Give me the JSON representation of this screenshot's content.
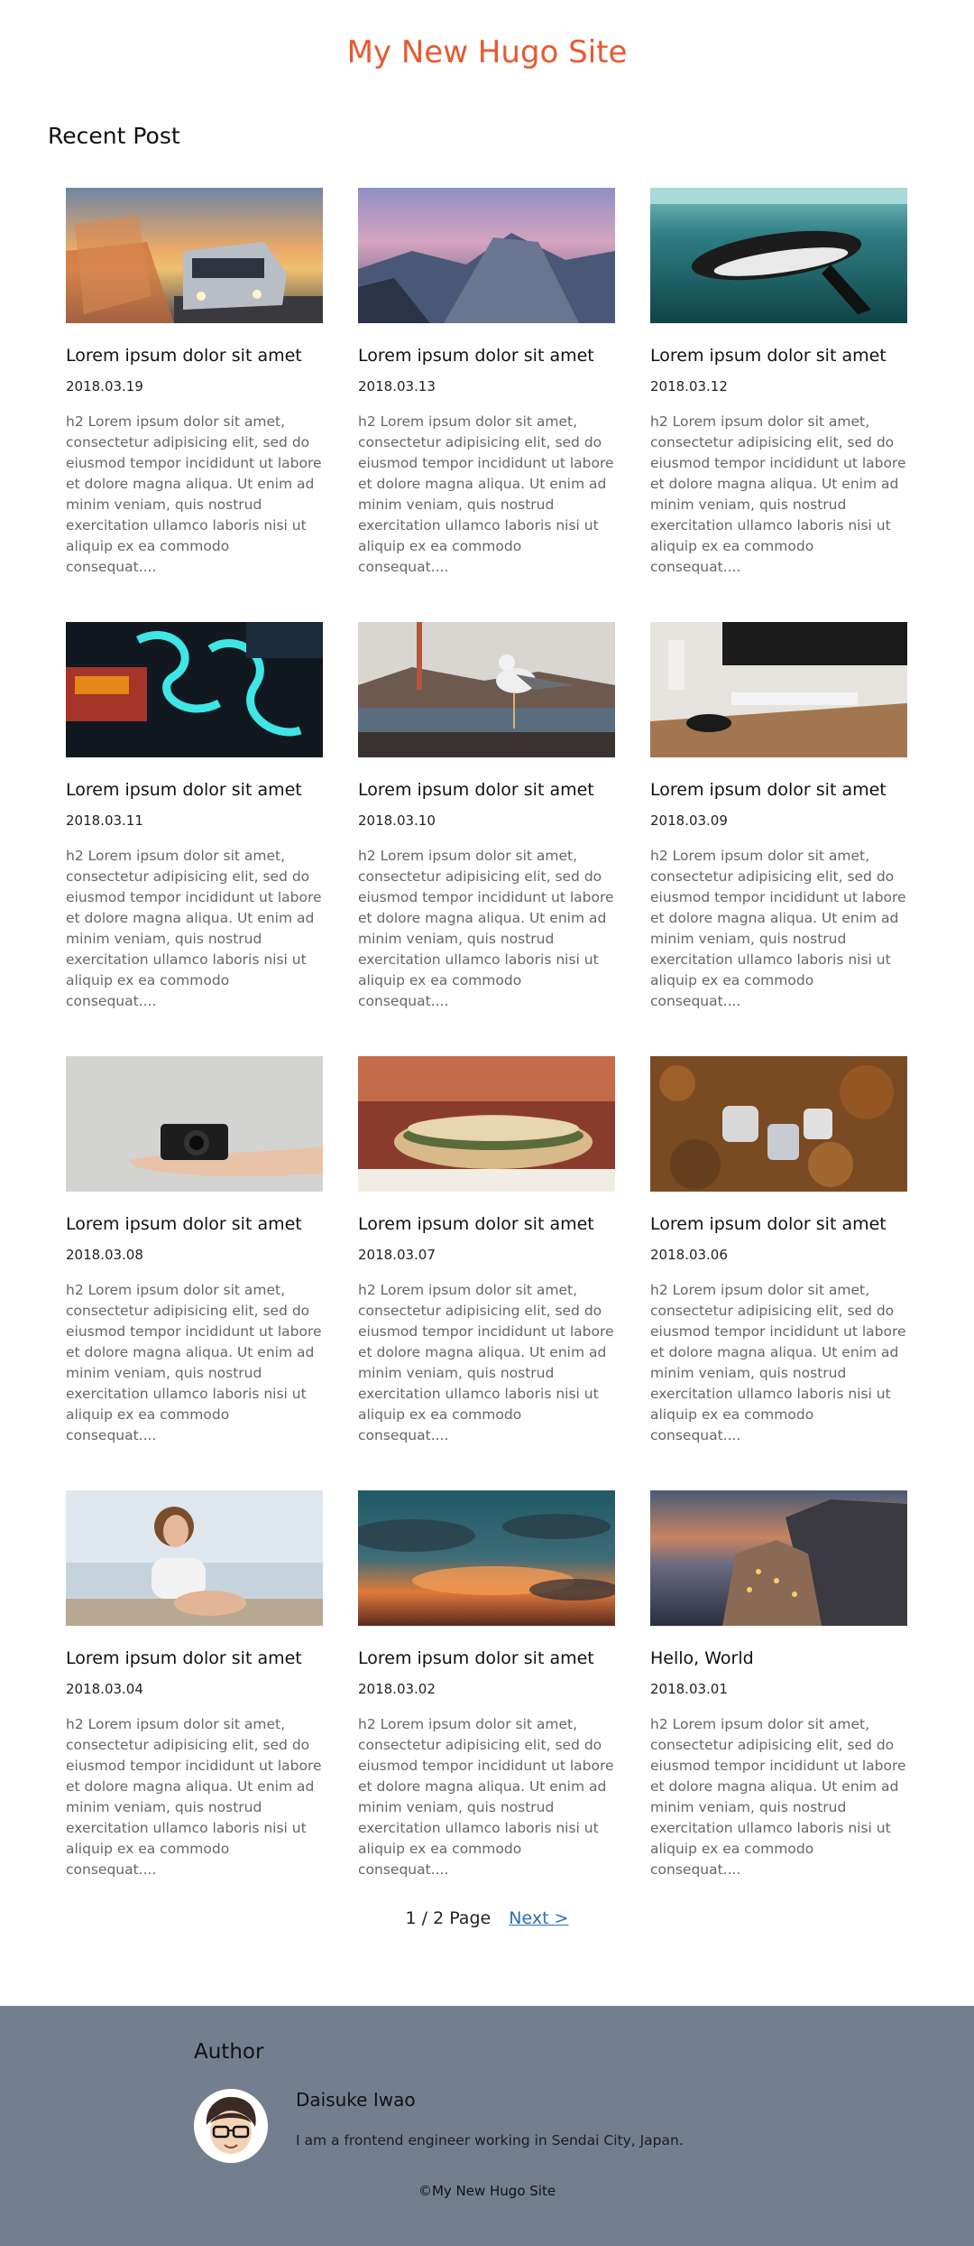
{
  "site": {
    "title": "My New Hugo Site"
  },
  "recent": {
    "heading": "Recent Post"
  },
  "posts": [
    {
      "title": "Lorem ipsum dolor sit amet",
      "date": "2018.03.19",
      "excerpt": "h2 Lorem ipsum dolor sit amet, consectetur adipisicing elit, sed do eiusmod tempor incididunt ut labore et dolore magna aliqua. Ut enim ad minim veniam, quis nostrud exercitation ullamco laboris nisi ut aliquip ex ea commodo consequat....",
      "image": "car-on-highway-image"
    },
    {
      "title": "Lorem ipsum dolor sit amet",
      "date": "2018.03.13",
      "excerpt": "h2 Lorem ipsum dolor sit amet, consectetur adipisicing elit, sed do eiusmod tempor incididunt ut labore et dolore magna aliqua. Ut enim ad minim veniam, quis nostrud exercitation ullamco laboris nisi ut aliquip ex ea commodo consequat....",
      "image": "mountain-valley-image"
    },
    {
      "title": "Lorem ipsum dolor sit amet",
      "date": "2018.03.12",
      "excerpt": "h2 Lorem ipsum dolor sit amet, consectetur adipisicing elit, sed do eiusmod tempor incididunt ut labore et dolore magna aliqua. Ut enim ad minim veniam, quis nostrud exercitation ullamco laboris nisi ut aliquip ex ea commodo consequat....",
      "image": "penguin-underwater-image"
    },
    {
      "title": "Lorem ipsum dolor sit amet",
      "date": "2018.03.11",
      "excerpt": "h2 Lorem ipsum dolor sit amet, consectetur adipisicing elit, sed do eiusmod tempor incididunt ut labore et dolore magna aliqua. Ut enim ad minim veniam, quis nostrud exercitation ullamco laboris nisi ut aliquip ex ea commodo consequat....",
      "image": "neon-sign-image"
    },
    {
      "title": "Lorem ipsum dolor sit amet",
      "date": "2018.03.10",
      "excerpt": "h2 Lorem ipsum dolor sit amet, consectetur adipisicing elit, sed do eiusmod tempor incididunt ut labore et dolore magna aliqua. Ut enim ad minim veniam, quis nostrud exercitation ullamco laboris nisi ut aliquip ex ea commodo consequat....",
      "image": "seagull-bridge-image"
    },
    {
      "title": "Lorem ipsum dolor sit amet",
      "date": "2018.03.09",
      "excerpt": "h2 Lorem ipsum dolor sit amet, consectetur adipisicing elit, sed do eiusmod tempor incididunt ut labore et dolore magna aliqua. Ut enim ad minim veniam, quis nostrud exercitation ullamco laboris nisi ut aliquip ex ea commodo consequat....",
      "image": "desk-computer-image"
    },
    {
      "title": "Lorem ipsum dolor sit amet",
      "date": "2018.03.08",
      "excerpt": "h2 Lorem ipsum dolor sit amet, consectetur adipisicing elit, sed do eiusmod tempor incididunt ut labore et dolore magna aliqua. Ut enim ad minim veniam, quis nostrud exercitation ullamco laboris nisi ut aliquip ex ea commodo consequat....",
      "image": "camera-on-hand-image"
    },
    {
      "title": "Lorem ipsum dolor sit amet",
      "date": "2018.03.07",
      "excerpt": "h2 Lorem ipsum dolor sit amet, consectetur adipisicing elit, sed do eiusmod tempor incididunt ut labore et dolore magna aliqua. Ut enim ad minim veniam, quis nostrud exercitation ullamco laboris nisi ut aliquip ex ea commodo consequat....",
      "image": "sandwich-image"
    },
    {
      "title": "Lorem ipsum dolor sit amet",
      "date": "2018.03.06",
      "excerpt": "h2 Lorem ipsum dolor sit amet, consectetur adipisicing elit, sed do eiusmod tempor incididunt ut labore et dolore magna aliqua. Ut enim ad minim veniam, quis nostrud exercitation ullamco laboris nisi ut aliquip ex ea commodo consequat....",
      "image": "autumn-leaves-image"
    },
    {
      "title": "Lorem ipsum dolor sit amet",
      "date": "2018.03.04",
      "excerpt": "h2 Lorem ipsum dolor sit amet, consectetur adipisicing elit, sed do eiusmod tempor incididunt ut labore et dolore magna aliqua. Ut enim ad minim veniam, quis nostrud exercitation ullamco laboris nisi ut aliquip ex ea commodo consequat....",
      "image": "woman-at-beach-image"
    },
    {
      "title": "Lorem ipsum dolor sit amet",
      "date": "2018.03.02",
      "excerpt": "h2 Lorem ipsum dolor sit amet, consectetur adipisicing elit, sed do eiusmod tempor incididunt ut labore et dolore magna aliqua. Ut enim ad minim veniam, quis nostrud exercitation ullamco laboris nisi ut aliquip ex ea commodo consequat....",
      "image": "sunset-sky-image"
    },
    {
      "title": "Hello, World",
      "date": "2018.03.01",
      "excerpt": "h2 Lorem ipsum dolor sit amet, consectetur adipisicing elit, sed do eiusmod tempor incididunt ut labore et dolore magna aliqua. Ut enim ad minim veniam, quis nostrud exercitation ullamco laboris nisi ut aliquip ex ea commodo consequat....",
      "image": "coastal-village-image"
    }
  ],
  "pagination": {
    "status": "1 / 2 Page",
    "next_label": "Next >"
  },
  "footer": {
    "author_heading": "Author",
    "author_name": "Daisuke Iwao",
    "author_bio": "I am a frontend engineer working in Sendai City, Japan.",
    "copyright": "©My New Hugo Site"
  },
  "colors": {
    "title": "#e8592e",
    "footer_bg": "#737e8f",
    "link": "#2a6fb4"
  }
}
